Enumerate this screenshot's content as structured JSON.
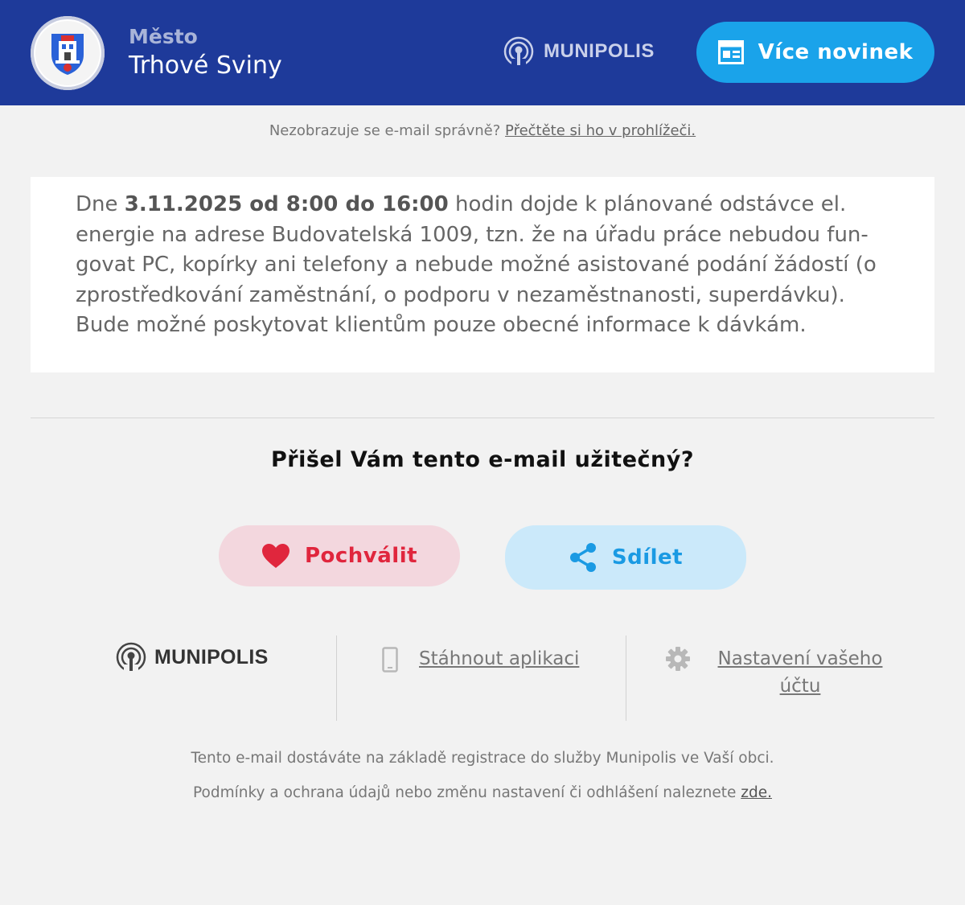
{
  "header": {
    "city_prefix": "Město",
    "city_name": "Trhové Sviny",
    "brand": "MUNIPOLIS",
    "more_news_label": "Více novinek"
  },
  "preheader": {
    "text": "Nezobrazuje se e-mail správně?",
    "link": "Přečtěte si ho v prohlížeči."
  },
  "message": {
    "before": "Dne ",
    "highlight": "3.11.2025 od 8:00 do 16:00",
    "after": " hodin dojde k plánované odstávce el. energie na adrese Budovatelská 1009, tzn. že na úřadu práce nebudou fun­govat PC, kopírky ani telefony a nebude možné asistované podání žádostí (o zprostředkování zaměstnání, o podporu v nezaměstnanosti, superdávku). Bude možné poskytovat klientům pouze obecné informace k dávkám."
  },
  "feedback": {
    "question": "Přišel Vám tento e-mail užitečný?",
    "praise_label": "Pochválit",
    "share_label": "Sdílet"
  },
  "footer": {
    "brand": "MUNIPOLIS",
    "download_app": "Stáhnout aplikaci",
    "account_settings": "Nastavení vašeho účtu"
  },
  "notes": {
    "line1": "Tento e-mail dostáváte na základě registrace do služby Munipolis ve Vaší obci.",
    "line2": "Podmínky a ochrana údajů nebo změnu nastavení či odhlášení naleznete",
    "line2_link": "zde."
  },
  "colors": {
    "header_bg": "#1e3a9a",
    "accent_blue": "#1aa3ea",
    "praise_red": "#e0263d",
    "page_bg": "#f2f2f2"
  },
  "icons": {
    "crest": "city-crest-icon",
    "brand": "munipolis-signal-icon",
    "more_news": "newspaper-icon",
    "praise": "heart-icon",
    "share": "share-icon",
    "download": "mobile-phone-icon",
    "settings": "gear-icon"
  }
}
